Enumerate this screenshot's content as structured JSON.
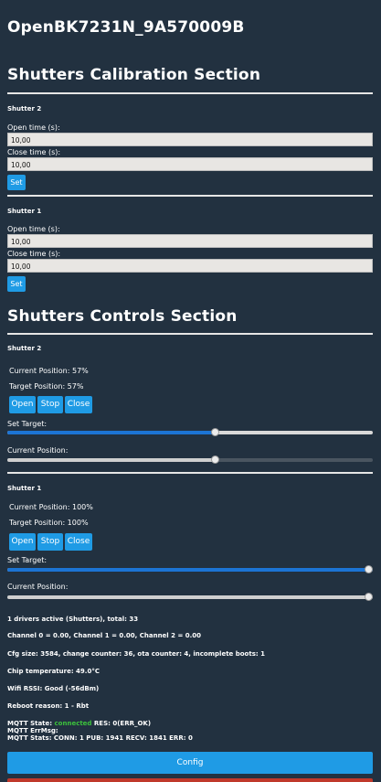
{
  "device_title": "OpenBK7231N_9A570009B",
  "calibration": {
    "title": "Shutters Calibration Section",
    "shutters": [
      {
        "name": "Shutter 2",
        "open_label": "Open time (s):",
        "open_value": "10,00",
        "close_label": "Close time (s):",
        "close_value": "10,00",
        "set_label": "Set"
      },
      {
        "name": "Shutter 1",
        "open_label": "Open time (s):",
        "open_value": "10,00",
        "close_label": "Close time (s):",
        "close_value": "10,00",
        "set_label": "Set"
      }
    ]
  },
  "controls": {
    "title": "Shutters Controls Section",
    "shutters": [
      {
        "name": "Shutter 2",
        "current_position": "Current Position: 57%",
        "target_position": "Target Position: 57%",
        "open_label": "Open",
        "stop_label": "Stop",
        "close_label": "Close",
        "set_target_label": "Set Target:",
        "current_slider_label": "Current Position:",
        "target_value": 57,
        "current_value": 57
      },
      {
        "name": "Shutter 1",
        "current_position": "Current Position: 100%",
        "target_position": "Target Position: 100%",
        "open_label": "Open",
        "stop_label": "Stop",
        "close_label": "Close",
        "set_target_label": "Set Target:",
        "current_slider_label": "Current Position:",
        "target_value": 100,
        "current_value": 100
      }
    ]
  },
  "status": {
    "drivers": "1 drivers active (Shutters), total: 33",
    "channels": "Channel 0 = 0.00, Channel 1 = 0.00, Channel 2 = 0.00",
    "cfg": "Cfg size: 3584, change counter: 36, ota counter: 4, incomplete boots: 1",
    "chip_temp": "Chip temperature: 49.0°C",
    "wifi": "Wifi RSSI: Good (-56dBm)",
    "reboot": "Reboot reason: 1 - Rbt",
    "mqtt_state_prefix": "MQTT State:",
    "mqtt_state_value": "connected",
    "mqtt_state_suffix": "RES: 0(ERR_OK)",
    "mqtt_errmsg": "MQTT ErrMsg:",
    "mqtt_stats": "MQTT Stats: CONN: 1 PUB: 1941 RECV: 1841 ERR: 0"
  },
  "config_button": "Config",
  "colors": {
    "background": "#223140",
    "accent": "#1f9be5",
    "connected": "#3cc23c",
    "bottom_bar": "#c0392b"
  }
}
